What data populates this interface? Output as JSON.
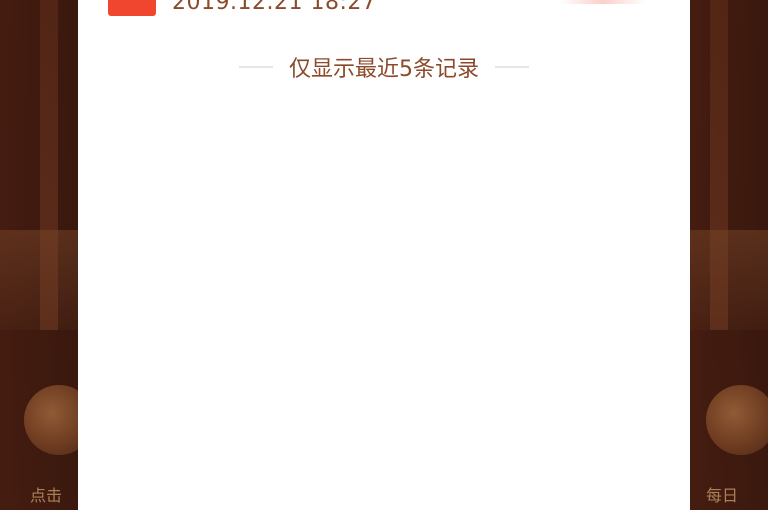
{
  "last_record": {
    "time": "2019.12.21 18:27"
  },
  "footer_note": "仅显示最近5条记录",
  "background": {
    "left_label": "点击",
    "right_label": "每日"
  },
  "colors": {
    "accent_red": "#f0452f",
    "text_brown": "#8b4a2b",
    "divider": "#e6e6e6"
  }
}
